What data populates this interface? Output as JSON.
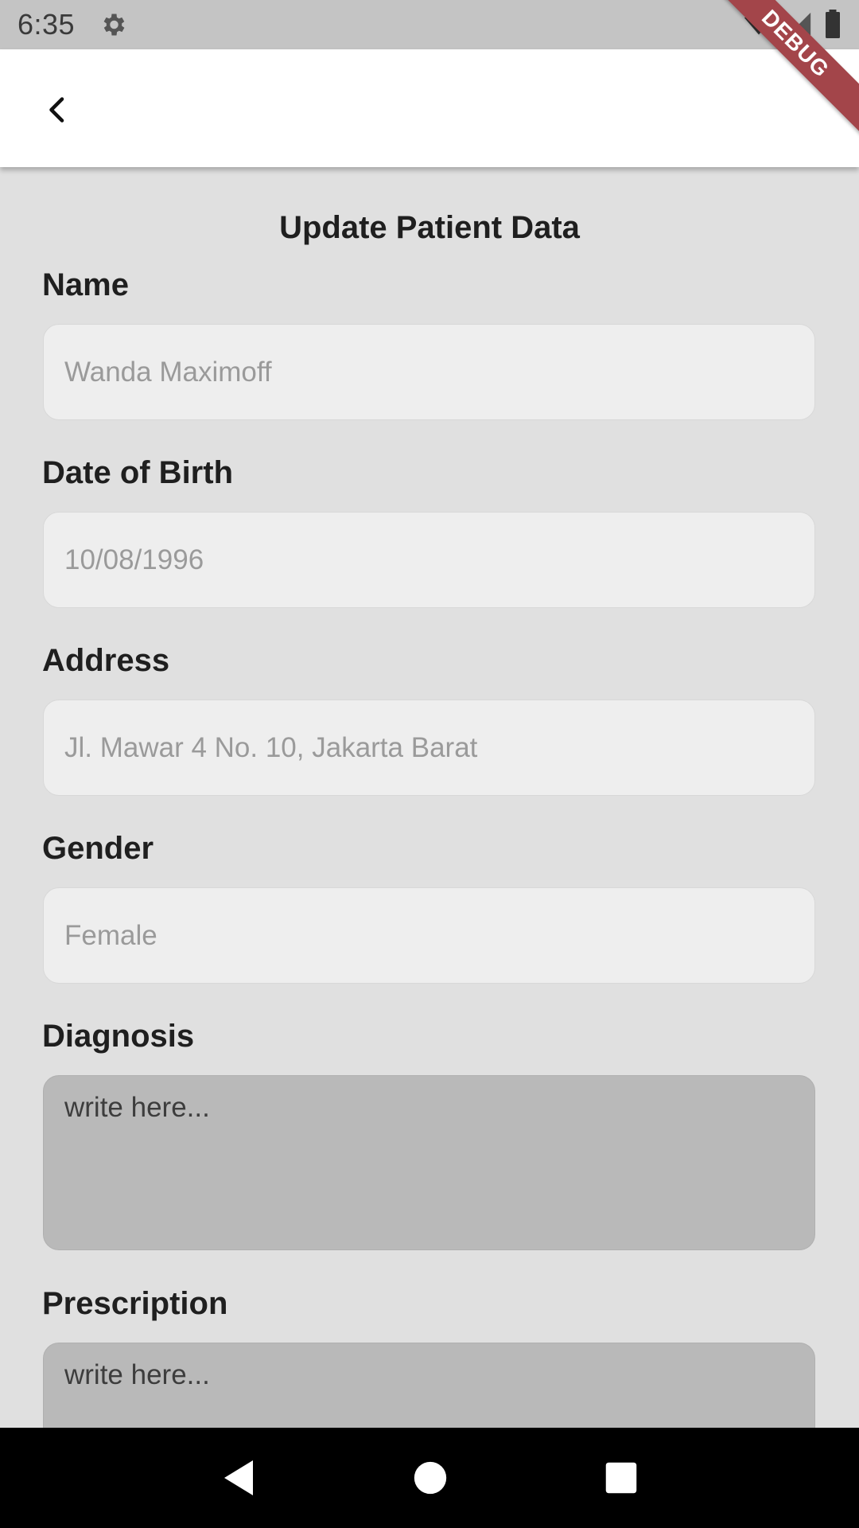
{
  "status_bar": {
    "time": "6:35"
  },
  "debug_banner": {
    "label": "DEBUG"
  },
  "page": {
    "title": "Update Patient Data"
  },
  "form": {
    "name": {
      "label": "Name",
      "placeholder": "Wanda Maximoff"
    },
    "dob": {
      "label": "Date of Birth",
      "placeholder": "10/08/1996"
    },
    "address": {
      "label": "Address",
      "placeholder": "Jl. Mawar 4 No. 10, Jakarta Barat"
    },
    "gender": {
      "label": "Gender",
      "placeholder": "Female"
    },
    "diagnosis": {
      "label": "Diagnosis",
      "placeholder": "write here..."
    },
    "prescription": {
      "label": "Prescription",
      "placeholder": "write here..."
    }
  },
  "colors": {
    "background": "#e0e0e0",
    "app_bar": "#ffffff",
    "input_fill": "#eeeeee",
    "textarea_fill": "#b9b9b9",
    "debug_banner": "#a3454a"
  },
  "icons": [
    "settings-gear-icon",
    "wifi-icon",
    "signal-icon",
    "battery-icon",
    "back-arrow-icon",
    "nav-back-icon",
    "nav-home-icon",
    "nav-recents-icon"
  ]
}
